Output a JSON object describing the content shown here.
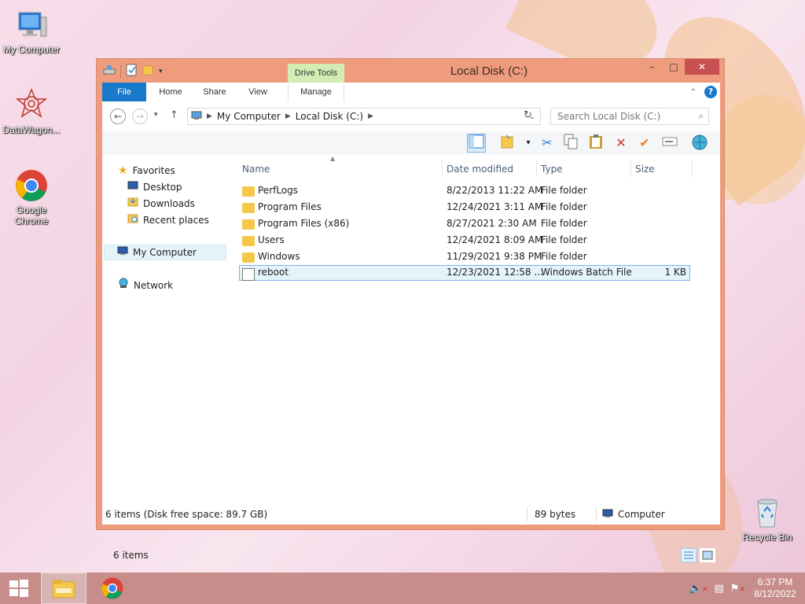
{
  "desktop": {
    "icons": [
      {
        "label": "My Computer",
        "icon": "computer-icon"
      },
      {
        "label": "DataWagon...",
        "icon": "datawagon-icon"
      },
      {
        "label": "Google Chrome",
        "icon": "chrome-icon"
      },
      {
        "label": "Recycle Bin",
        "icon": "recycle-bin-icon"
      }
    ]
  },
  "window": {
    "title": "Local Disk (C:)",
    "tabs": {
      "file": "File",
      "home": "Home",
      "share": "Share",
      "view": "View",
      "manage": "Manage",
      "drive_tools": "Drive Tools"
    },
    "address": {
      "crumb1": "My Computer",
      "crumb2": "Local Disk (C:)"
    },
    "search_placeholder": "Search Local Disk (C:)",
    "nav": {
      "favorites": "Favorites",
      "desktop": "Desktop",
      "downloads": "Downloads",
      "recent": "Recent places",
      "my_computer": "My Computer",
      "network": "Network"
    },
    "columns": {
      "name": "Name",
      "date": "Date modified",
      "type": "Type",
      "size": "Size"
    },
    "files": [
      {
        "name": "PerfLogs",
        "date": "8/22/2013 11:22 AM",
        "type": "File folder",
        "size": ""
      },
      {
        "name": "Program Files",
        "date": "12/24/2021 3:11 AM",
        "type": "File folder",
        "size": ""
      },
      {
        "name": "Program Files (x86)",
        "date": "8/27/2021 2:30 AM",
        "type": "File folder",
        "size": ""
      },
      {
        "name": "Users",
        "date": "12/24/2021 8:09 AM",
        "type": "File folder",
        "size": ""
      },
      {
        "name": "Windows",
        "date": "11/29/2021 9:38 PM",
        "type": "File folder",
        "size": ""
      },
      {
        "name": "reboot",
        "date": "12/23/2021 12:58 ...",
        "type": "Windows Batch File",
        "size": "1 KB"
      }
    ],
    "item_count": "6 items",
    "status": {
      "left": "6 items (Disk free space: 89.7 GB)",
      "bytes": "89 bytes",
      "location": "Computer"
    }
  },
  "taskbar": {
    "time": "6:37 PM",
    "date": "8/12/2022"
  },
  "colors": {
    "titlebar": "#ef9c7e",
    "file_tab": "#1979ca",
    "drive_tools": "#d3ecb4",
    "taskbar": "#c78d8b",
    "close": "#c75050"
  }
}
